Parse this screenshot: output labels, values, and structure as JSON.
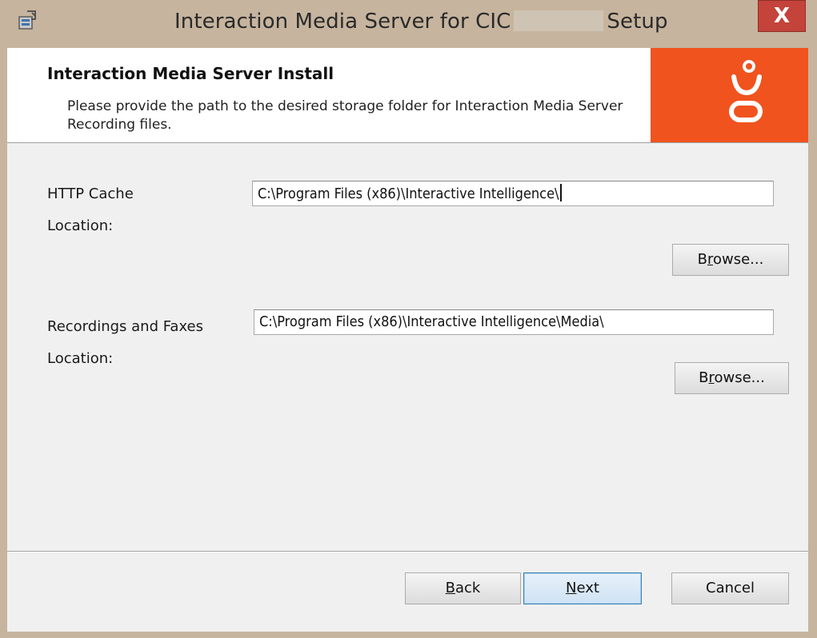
{
  "window": {
    "title_prefix": "Interaction Media Server for CIC",
    "title_suffix": "Setup",
    "close_glyph": "X"
  },
  "banner": {
    "title": "Interaction Media Server Install",
    "description": "Please provide the path to the desired storage folder for Interaction Media Server Recording files.",
    "logo_icon": "genesys-logo-icon",
    "logo_color": "#F0531E"
  },
  "http_cache": {
    "label_line1": "HTTP Cache",
    "label_line2": "Location:",
    "value": "C:\\Program Files (x86)\\Interactive Intelligence\\",
    "browse_label_pre": "B",
    "browse_label_mnemonic": "r",
    "browse_label_post": "owse..."
  },
  "recordings": {
    "label_line1": "Recordings and Faxes",
    "label_line2": "Location:",
    "value": "C:\\Program Files (x86)\\Interactive Intelligence\\Media\\",
    "browse_label_pre": "B",
    "browse_label_mnemonic": "r",
    "browse_label_post": "owse..."
  },
  "footer": {
    "back_mnemonic": "B",
    "back_rest": "ack",
    "next_mnemonic": "N",
    "next_rest": "ext",
    "cancel_label": "Cancel"
  }
}
